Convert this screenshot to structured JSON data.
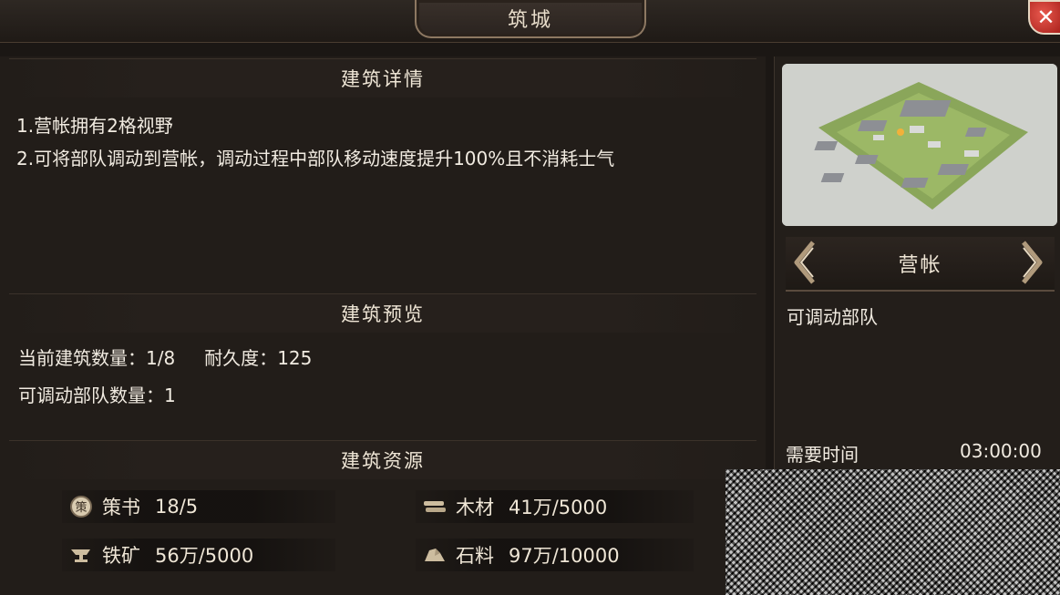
{
  "window": {
    "title": "筑城",
    "close_icon": "close-icon"
  },
  "details": {
    "header": "建筑详情",
    "line1": "1.营帐拥有2格视野",
    "line2": "2.可将部队调动到营帐，调动过程中部队移动速度提升100%且不消耗士气"
  },
  "preview": {
    "header": "建筑预览",
    "count_label": "当前建筑数量：",
    "count_value": "1/8",
    "durability_label": "耐久度：",
    "durability_value": "125",
    "deploy_label": "可调动部队数量：",
    "deploy_value": "1"
  },
  "resources": {
    "header": "建筑资源",
    "items": [
      {
        "icon": "strategy-book-icon",
        "name": "策书",
        "value": "18/5"
      },
      {
        "icon": "wood-icon",
        "name": "木材",
        "value": "41万/5000"
      },
      {
        "icon": "iron-anvil-icon",
        "name": "铁矿",
        "value": "56万/5000"
      },
      {
        "icon": "stone-icon",
        "name": "石料",
        "value": "97万/10000"
      }
    ]
  },
  "building": {
    "name": "营帐",
    "description": "可调动部队",
    "time_label": "需要时间",
    "time_value": "03:00:00"
  }
}
